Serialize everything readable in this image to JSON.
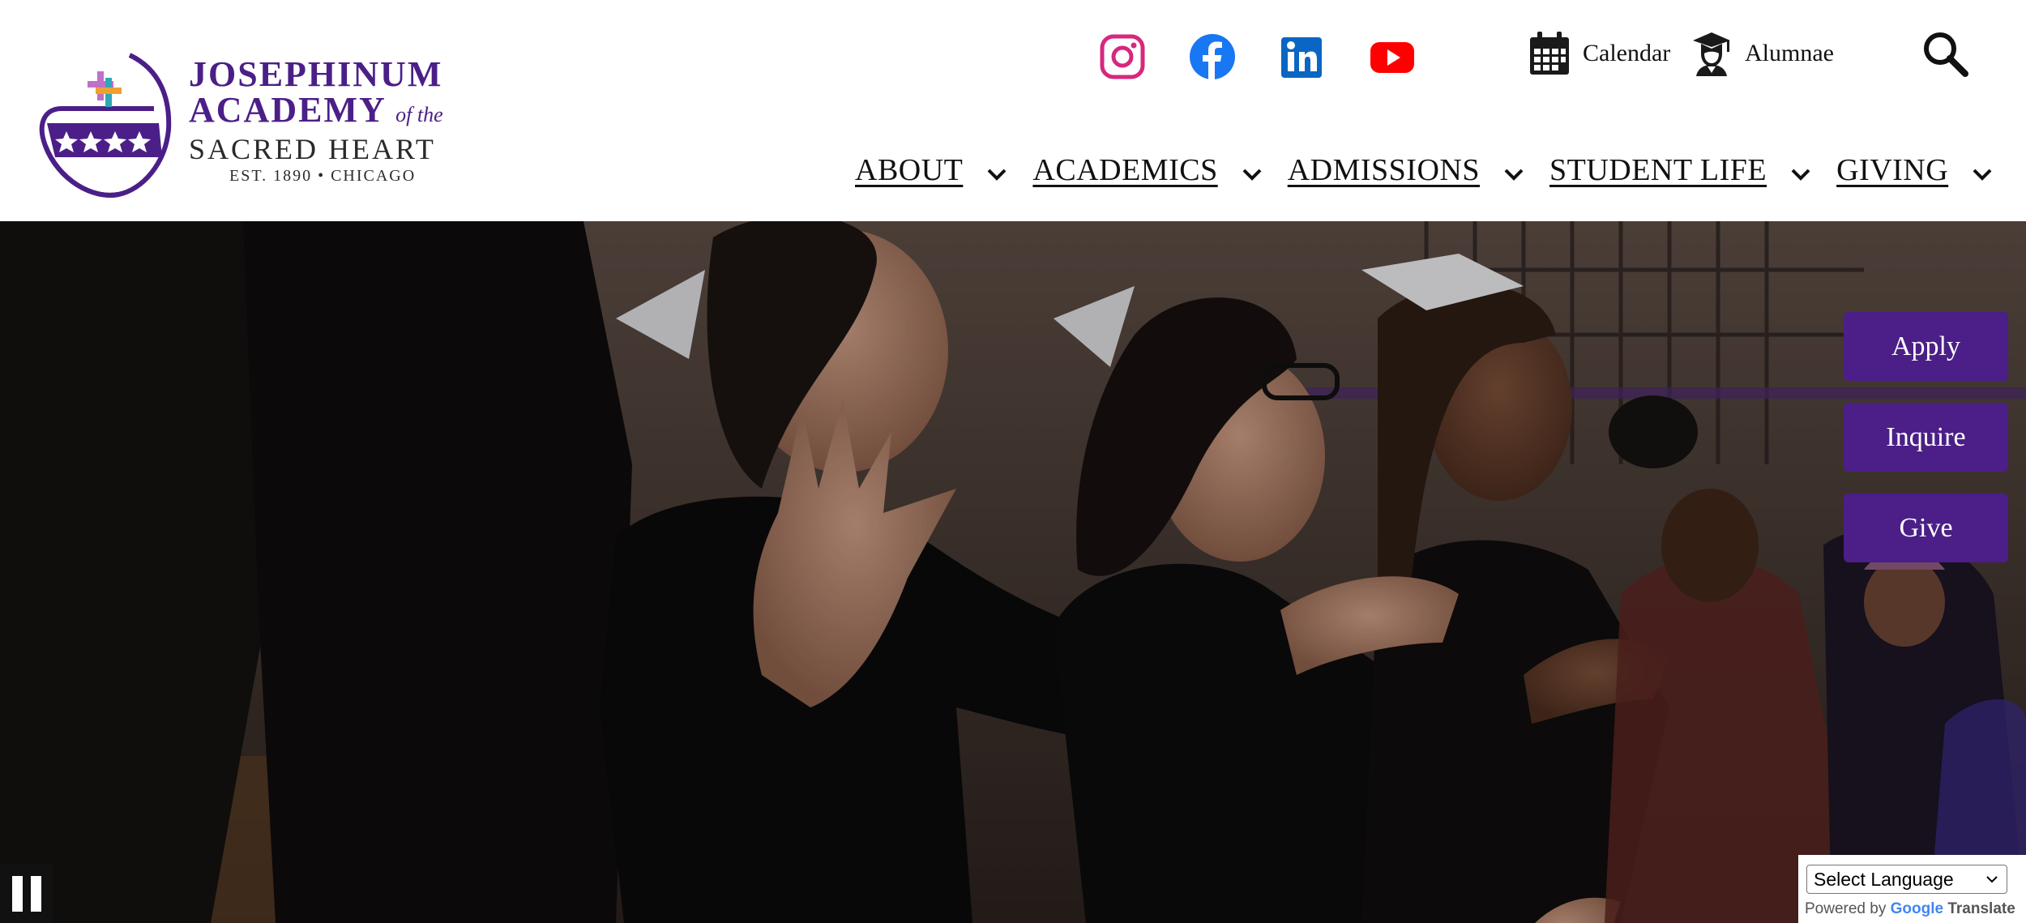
{
  "logo": {
    "line1": "JOSEPHINUM",
    "line2_main": "ACADEMY",
    "line2_italic": "of the",
    "line3": "SACRED HEART",
    "line4": "EST. 1890 • CHICAGO",
    "icon": "heart-cross-stars-logo"
  },
  "social": [
    {
      "name": "instagram",
      "icon": "instagram-icon",
      "color": "#d6287c"
    },
    {
      "name": "facebook",
      "icon": "facebook-icon",
      "color": "#1877f2"
    },
    {
      "name": "linkedin",
      "icon": "linkedin-icon",
      "color": "#0a66c2"
    },
    {
      "name": "youtube",
      "icon": "youtube-icon",
      "color": "#ff0000"
    }
  ],
  "utility": {
    "calendar": {
      "label": "Calendar",
      "icon": "calendar-icon"
    },
    "alumnae": {
      "label": "Alumnae",
      "icon": "graduate-icon"
    },
    "search": {
      "icon": "search-icon"
    }
  },
  "nav": [
    {
      "label": "ABOUT"
    },
    {
      "label": "ACADEMICS"
    },
    {
      "label": "ADMISSIONS"
    },
    {
      "label": "STUDENT LIFE"
    },
    {
      "label": "GIVING"
    }
  ],
  "cta": {
    "apply": "Apply",
    "inquire": "Inquire",
    "give": "Give"
  },
  "hero": {
    "image": "students cheering in black outfits in a gymnasium",
    "pause_icon": "pause-icon"
  },
  "translate": {
    "select_label": "Select Language",
    "powered_by": "Powered by",
    "google": "Google",
    "translate": "Translate"
  },
  "colors": {
    "brand_purple": "#4b1f87",
    "nav_text": "#111111"
  }
}
